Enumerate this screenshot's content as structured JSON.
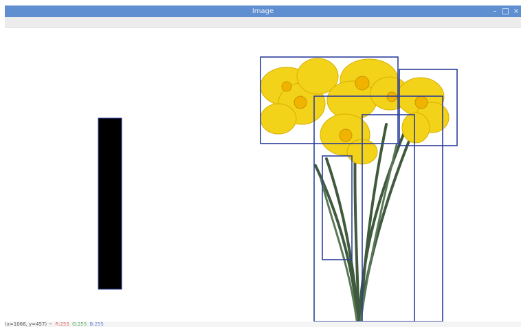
{
  "window": {
    "title": "Image"
  },
  "controls": {
    "minimize": "–",
    "close": "×"
  },
  "statusbar": {
    "coords": "(x=1066, y=457) ~",
    "r": "R:255",
    "g": "G:255",
    "b": "B:255",
    "colors": {
      "text": "#555555",
      "r": "#e06a6a",
      "g": "#5fb35f",
      "b": "#6a84d8"
    }
  },
  "colors": {
    "titlebar": "#5f8fd0",
    "box": "#2b3e9a",
    "bar": "#000000",
    "petal": "#f3d21a",
    "stem": "#3f5a3d"
  }
}
